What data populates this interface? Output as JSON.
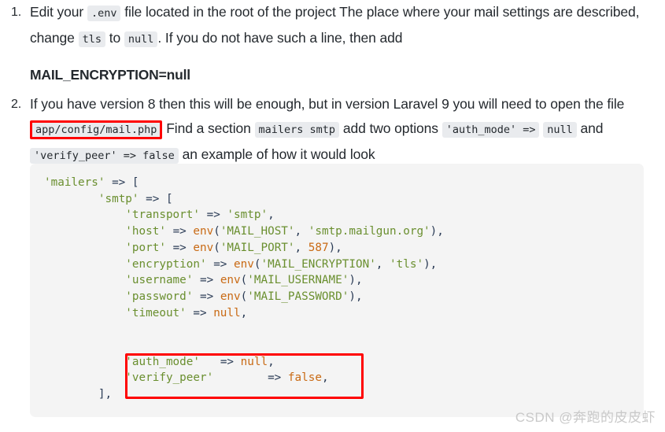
{
  "document": {
    "steps": [
      {
        "marker": "1.",
        "segments": [
          {
            "type": "text",
            "text": "Edit your "
          },
          {
            "type": "code",
            "text": ".env"
          },
          {
            "type": "text",
            "text": " file located in the root of the project The place where your mail settings are described, change "
          },
          {
            "type": "code",
            "text": "tls"
          },
          {
            "type": "text",
            "text": " to "
          },
          {
            "type": "code",
            "text": "null"
          },
          {
            "type": "text",
            "text": ". If you do not have such a line, then add"
          }
        ],
        "emphasis_line": "MAIL_ENCRYPTION=null"
      },
      {
        "marker": "2.",
        "segments": [
          {
            "type": "text",
            "text": "If you have version 8 then this will be enough, but in version Laravel 9 you will need to open the file "
          },
          {
            "type": "code-boxed",
            "text": "app/config/mail.php"
          },
          {
            "type": "text",
            "text": " Find a section "
          },
          {
            "type": "code",
            "text": "mailers smtp"
          },
          {
            "type": "text",
            "text": " add two options "
          },
          {
            "type": "code",
            "text": "'auth_mode' =>"
          },
          {
            "type": "text",
            "text": " "
          },
          {
            "type": "code",
            "text": "null"
          },
          {
            "type": "text",
            "text": " and "
          },
          {
            "type": "code",
            "text": "'verify_peer' => false"
          },
          {
            "type": "text",
            "text": " an example of how it would look"
          }
        ],
        "emphasis_line": ""
      }
    ]
  },
  "code_block": {
    "language": "php",
    "lines": [
      [
        {
          "t": "'mailers'",
          "c": "str"
        },
        {
          "t": " ",
          "c": "plain"
        },
        {
          "t": "=>",
          "c": "punc"
        },
        {
          "t": " ",
          "c": "plain"
        },
        {
          "t": "[",
          "c": "punc"
        }
      ],
      [
        {
          "t": "        ",
          "c": "plain"
        },
        {
          "t": "'smtp'",
          "c": "str"
        },
        {
          "t": " ",
          "c": "plain"
        },
        {
          "t": "=>",
          "c": "punc"
        },
        {
          "t": " ",
          "c": "plain"
        },
        {
          "t": "[",
          "c": "punc"
        }
      ],
      [
        {
          "t": "            ",
          "c": "plain"
        },
        {
          "t": "'transport'",
          "c": "str"
        },
        {
          "t": " ",
          "c": "plain"
        },
        {
          "t": "=>",
          "c": "punc"
        },
        {
          "t": " ",
          "c": "plain"
        },
        {
          "t": "'smtp'",
          "c": "str"
        },
        {
          "t": ",",
          "c": "punc"
        }
      ],
      [
        {
          "t": "            ",
          "c": "plain"
        },
        {
          "t": "'host'",
          "c": "str"
        },
        {
          "t": " ",
          "c": "plain"
        },
        {
          "t": "=>",
          "c": "punc"
        },
        {
          "t": " ",
          "c": "plain"
        },
        {
          "t": "env",
          "c": "fn"
        },
        {
          "t": "(",
          "c": "punc"
        },
        {
          "t": "'MAIL_HOST'",
          "c": "str"
        },
        {
          "t": ", ",
          "c": "punc"
        },
        {
          "t": "'smtp.mailgun.org'",
          "c": "str"
        },
        {
          "t": "),",
          "c": "punc"
        }
      ],
      [
        {
          "t": "            ",
          "c": "plain"
        },
        {
          "t": "'port'",
          "c": "str"
        },
        {
          "t": " ",
          "c": "plain"
        },
        {
          "t": "=>",
          "c": "punc"
        },
        {
          "t": " ",
          "c": "plain"
        },
        {
          "t": "env",
          "c": "fn"
        },
        {
          "t": "(",
          "c": "punc"
        },
        {
          "t": "'MAIL_PORT'",
          "c": "str"
        },
        {
          "t": ", ",
          "c": "punc"
        },
        {
          "t": "587",
          "c": "num"
        },
        {
          "t": "),",
          "c": "punc"
        }
      ],
      [
        {
          "t": "            ",
          "c": "plain"
        },
        {
          "t": "'encryption'",
          "c": "str"
        },
        {
          "t": " ",
          "c": "plain"
        },
        {
          "t": "=>",
          "c": "punc"
        },
        {
          "t": " ",
          "c": "plain"
        },
        {
          "t": "env",
          "c": "fn"
        },
        {
          "t": "(",
          "c": "punc"
        },
        {
          "t": "'MAIL_ENCRYPTION'",
          "c": "str"
        },
        {
          "t": ", ",
          "c": "punc"
        },
        {
          "t": "'tls'",
          "c": "str"
        },
        {
          "t": "),",
          "c": "punc"
        }
      ],
      [
        {
          "t": "            ",
          "c": "plain"
        },
        {
          "t": "'username'",
          "c": "str"
        },
        {
          "t": " ",
          "c": "plain"
        },
        {
          "t": "=>",
          "c": "punc"
        },
        {
          "t": " ",
          "c": "plain"
        },
        {
          "t": "env",
          "c": "fn"
        },
        {
          "t": "(",
          "c": "punc"
        },
        {
          "t": "'MAIL_USERNAME'",
          "c": "str"
        },
        {
          "t": "),",
          "c": "punc"
        }
      ],
      [
        {
          "t": "            ",
          "c": "plain"
        },
        {
          "t": "'password'",
          "c": "str"
        },
        {
          "t": " ",
          "c": "plain"
        },
        {
          "t": "=>",
          "c": "punc"
        },
        {
          "t": " ",
          "c": "plain"
        },
        {
          "t": "env",
          "c": "fn"
        },
        {
          "t": "(",
          "c": "punc"
        },
        {
          "t": "'MAIL_PASSWORD'",
          "c": "str"
        },
        {
          "t": "),",
          "c": "punc"
        }
      ],
      [
        {
          "t": "            ",
          "c": "plain"
        },
        {
          "t": "'timeout'",
          "c": "str"
        },
        {
          "t": " ",
          "c": "plain"
        },
        {
          "t": "=>",
          "c": "punc"
        },
        {
          "t": " ",
          "c": "plain"
        },
        {
          "t": "null",
          "c": "kw"
        },
        {
          "t": ",",
          "c": "punc"
        }
      ],
      [
        {
          "t": "",
          "c": "plain"
        }
      ],
      [
        {
          "t": "",
          "c": "plain"
        }
      ],
      [
        {
          "t": "            ",
          "c": "plain"
        },
        {
          "t": "'auth_mode'",
          "c": "str"
        },
        {
          "t": "   ",
          "c": "plain"
        },
        {
          "t": "=>",
          "c": "punc"
        },
        {
          "t": " ",
          "c": "plain"
        },
        {
          "t": "null",
          "c": "kw"
        },
        {
          "t": ",",
          "c": "punc"
        }
      ],
      [
        {
          "t": "            ",
          "c": "plain"
        },
        {
          "t": "'verify_peer'",
          "c": "str"
        },
        {
          "t": "        ",
          "c": "plain"
        },
        {
          "t": "=>",
          "c": "punc"
        },
        {
          "t": " ",
          "c": "plain"
        },
        {
          "t": "false",
          "c": "kw"
        },
        {
          "t": ",",
          "c": "punc"
        }
      ],
      [
        {
          "t": "        ",
          "c": "plain"
        },
        {
          "t": "],",
          "c": "punc"
        }
      ]
    ]
  },
  "highlights": {
    "box_color": "#ff0000",
    "inline_boxed_text": "app/config/mail.php",
    "code_boxed_lines": [
      "'auth_mode'   => null,",
      "'verify_peer'        => false,"
    ]
  },
  "watermark": {
    "text": "CSDN @奔跑的皮皮虾"
  },
  "colors": {
    "page_background": "#ffffff",
    "code_background": "#f4f4f4",
    "inline_chip_background": "#e9ebee",
    "text": "#24292e",
    "string": "#6a8f2f",
    "function": "#c96a14",
    "number": "#c96a14",
    "keyword": "#c96a14",
    "punctuation": "#2a3b55",
    "highlight_red": "#ff0000",
    "watermark": "#c9c9c9"
  }
}
